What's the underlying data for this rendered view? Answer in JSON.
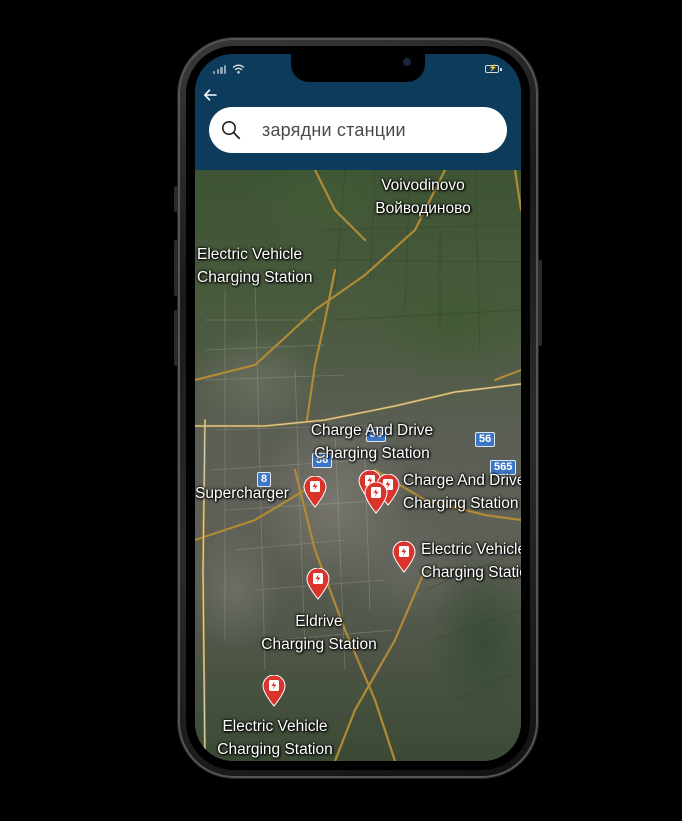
{
  "header": {
    "search": {
      "value": "зарядни станции"
    }
  },
  "map": {
    "place_labels": [
      {
        "text": "Voivodinovo\nВойводиново"
      },
      {
        "text": "Electric Vehicle\nCharging Station"
      },
      {
        "text": "Charge And Drive\nCharging Station"
      },
      {
        "text": "Supercharger"
      },
      {
        "text": "Charge And Drive\nCharging Station"
      },
      {
        "text": "Electric Vehicle\nCharging Station"
      },
      {
        "text": "Eldrive\nCharging Station"
      },
      {
        "text": "Electric Vehicle\nCharging Station"
      }
    ],
    "road_shields": [
      "56",
      "56",
      "56",
      "565",
      "8"
    ],
    "pin_color": "#d9342b"
  }
}
